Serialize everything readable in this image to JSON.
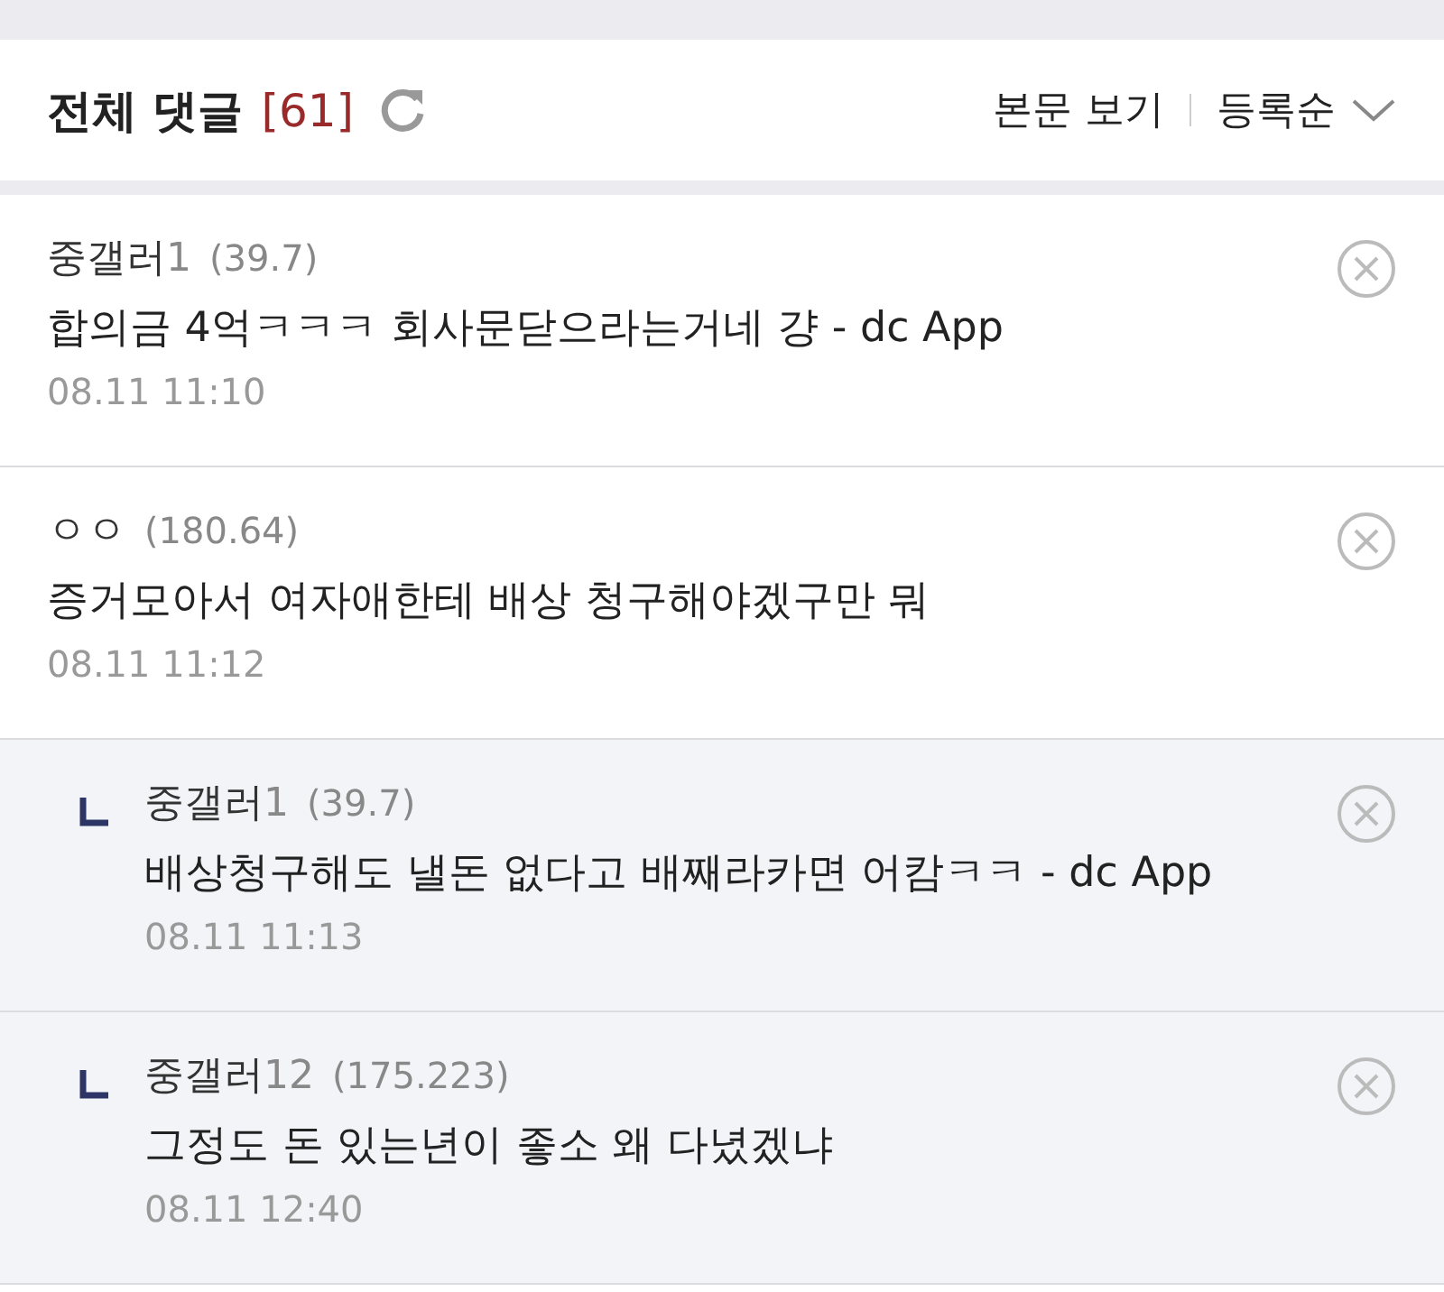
{
  "header": {
    "title": "전체 댓글",
    "count": "[61]",
    "view_body": "본문 보기",
    "sort": "등록순"
  },
  "comments": [
    {
      "kind": "comment",
      "nick": "중갤러",
      "nick_suffix": "1",
      "ip": "(39.7)",
      "text": "합의금 4억ㅋㅋㅋ 회사문닫으라는거네 걍 - dc App",
      "date": "08.11 11:10"
    },
    {
      "kind": "comment",
      "nick": "ㅇㅇ",
      "ip": "(180.64)",
      "text": "증거모아서 여자애한테 배상 청구해야겠구만 뭐",
      "date": "08.11 11:12"
    },
    {
      "kind": "reply",
      "nick": "중갤러",
      "nick_suffix": "1",
      "ip": "(39.7)",
      "text": "배상청구해도 낼돈 없다고 배째라카면 어캄ㅋㅋ - dc App",
      "date": "08.11 11:13"
    },
    {
      "kind": "reply",
      "nick": "중갤러",
      "nick_suffix": "12",
      "ip": "(175.223)",
      "text": "그정도 돈 있는년이 좋소 왜 다녔겠냐",
      "date": "08.11 12:40"
    }
  ]
}
